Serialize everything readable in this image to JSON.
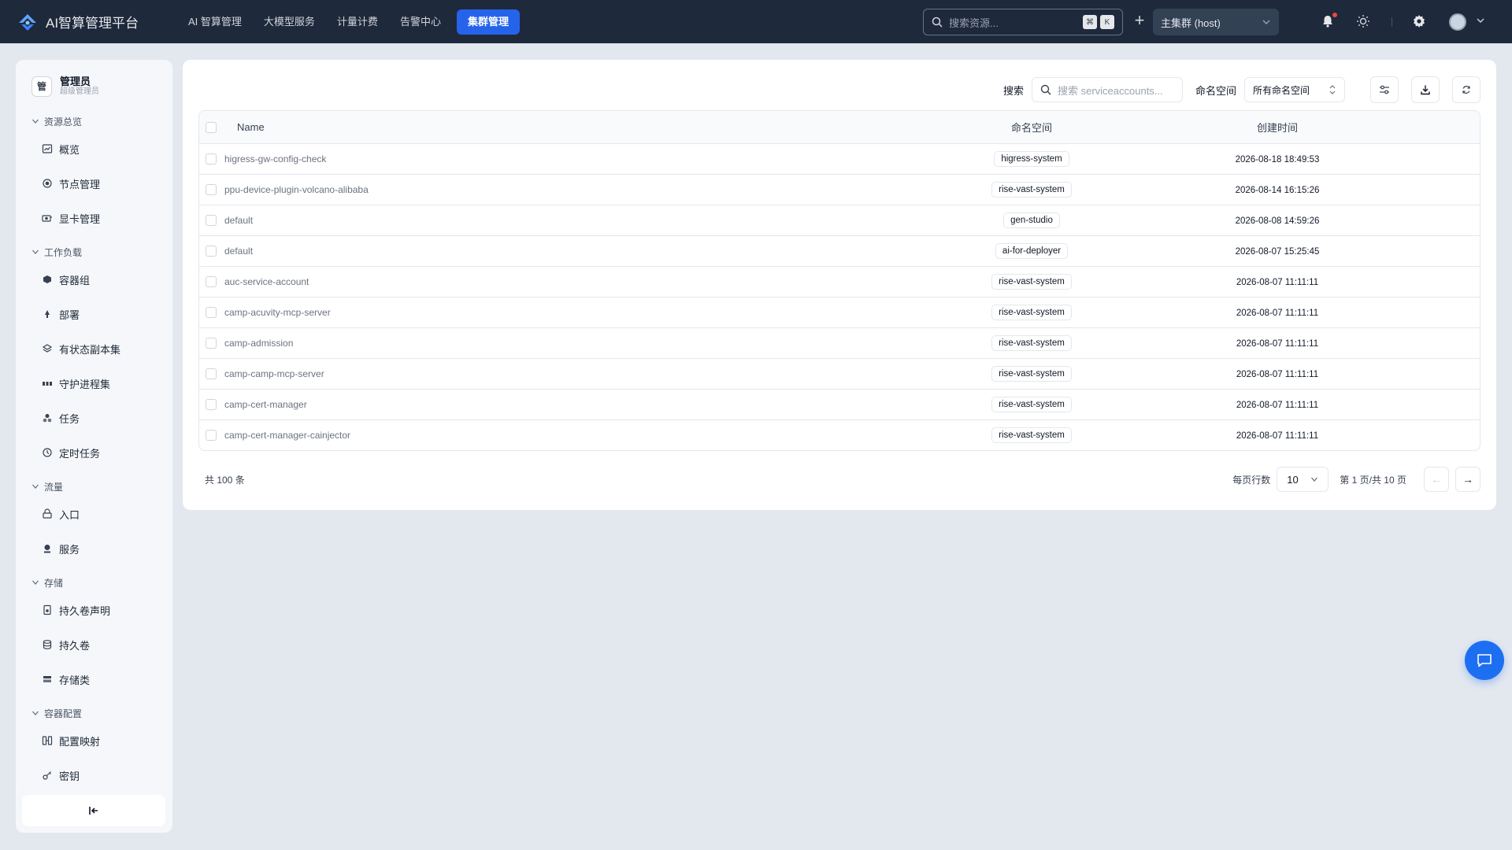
{
  "app": {
    "title": "AI智算管理平台"
  },
  "topnav": {
    "items": [
      "AI 智算管理",
      "大模型服务",
      "计量计费",
      "告警中心"
    ],
    "active": "集群管理"
  },
  "global_search": {
    "placeholder": "搜索资源...",
    "kbd1": "⌘",
    "kbd2": "K"
  },
  "cluster": {
    "selected": "主集群 (host)"
  },
  "user": {
    "avatar_char": "管",
    "name": "管理员",
    "role": "超级管理员"
  },
  "sidebar": {
    "groups": [
      {
        "label": "资源总览",
        "items": [
          {
            "label": "概览",
            "icon": "chart-icon"
          },
          {
            "label": "节点管理",
            "icon": "node-icon"
          },
          {
            "label": "显卡管理",
            "icon": "gpu-icon"
          }
        ]
      },
      {
        "label": "工作负载",
        "items": [
          {
            "label": "容器组",
            "icon": "cube-icon"
          },
          {
            "label": "部署",
            "icon": "deploy-icon"
          },
          {
            "label": "有状态副本集",
            "icon": "layers-icon"
          },
          {
            "label": "守护进程集",
            "icon": "daemon-icon"
          },
          {
            "label": "任务",
            "icon": "job-icon"
          },
          {
            "label": "定时任务",
            "icon": "clock-icon"
          }
        ]
      },
      {
        "label": "流量",
        "items": [
          {
            "label": "入口",
            "icon": "ingress-icon"
          },
          {
            "label": "服务",
            "icon": "service-icon"
          }
        ]
      },
      {
        "label": "存储",
        "items": [
          {
            "label": "持久卷声明",
            "icon": "pvc-icon"
          },
          {
            "label": "持久卷",
            "icon": "database-icon"
          },
          {
            "label": "存储类",
            "icon": "storage-class-icon"
          }
        ]
      },
      {
        "label": "容器配置",
        "items": [
          {
            "label": "配置映射",
            "icon": "configmap-icon"
          },
          {
            "label": "密钥",
            "icon": "key-icon"
          }
        ]
      }
    ]
  },
  "toolbar": {
    "search_label": "搜索",
    "search_placeholder": "搜索 serviceaccounts...",
    "namespace_label": "命名空间",
    "namespace_selected": "所有命名空间"
  },
  "table": {
    "columns": [
      "Name",
      "命名空间",
      "创建时间"
    ],
    "rows": [
      {
        "name": "higress-gw-config-check",
        "namespace": "higress-system",
        "created": "2026-08-18 18:49:53"
      },
      {
        "name": "ppu-device-plugin-volcano-alibaba",
        "namespace": "rise-vast-system",
        "created": "2026-08-14 16:15:26"
      },
      {
        "name": "default",
        "namespace": "gen-studio",
        "created": "2026-08-08 14:59:26"
      },
      {
        "name": "default",
        "namespace": "ai-for-deployer",
        "created": "2026-08-07 15:25:45"
      },
      {
        "name": "auc-service-account",
        "namespace": "rise-vast-system",
        "created": "2026-08-07 11:11:11"
      },
      {
        "name": "camp-acuvity-mcp-server",
        "namespace": "rise-vast-system",
        "created": "2026-08-07 11:11:11"
      },
      {
        "name": "camp-admission",
        "namespace": "rise-vast-system",
        "created": "2026-08-07 11:11:11"
      },
      {
        "name": "camp-camp-mcp-server",
        "namespace": "rise-vast-system",
        "created": "2026-08-07 11:11:11"
      },
      {
        "name": "camp-cert-manager",
        "namespace": "rise-vast-system",
        "created": "2026-08-07 11:11:11"
      },
      {
        "name": "camp-cert-manager-cainjector",
        "namespace": "rise-vast-system",
        "created": "2026-08-07 11:11:11"
      }
    ]
  },
  "pagination": {
    "total": "共 100 条",
    "rows_per_page_label": "每页行数",
    "rows_per_page": "10",
    "page_info": "第 1 页/共 10 页",
    "prev": "←",
    "next": "→"
  },
  "colors": {
    "topbar": "#1e293b",
    "accent": "#2563eb",
    "background": "#e3e8ef",
    "fab": "#1d6ff2"
  }
}
